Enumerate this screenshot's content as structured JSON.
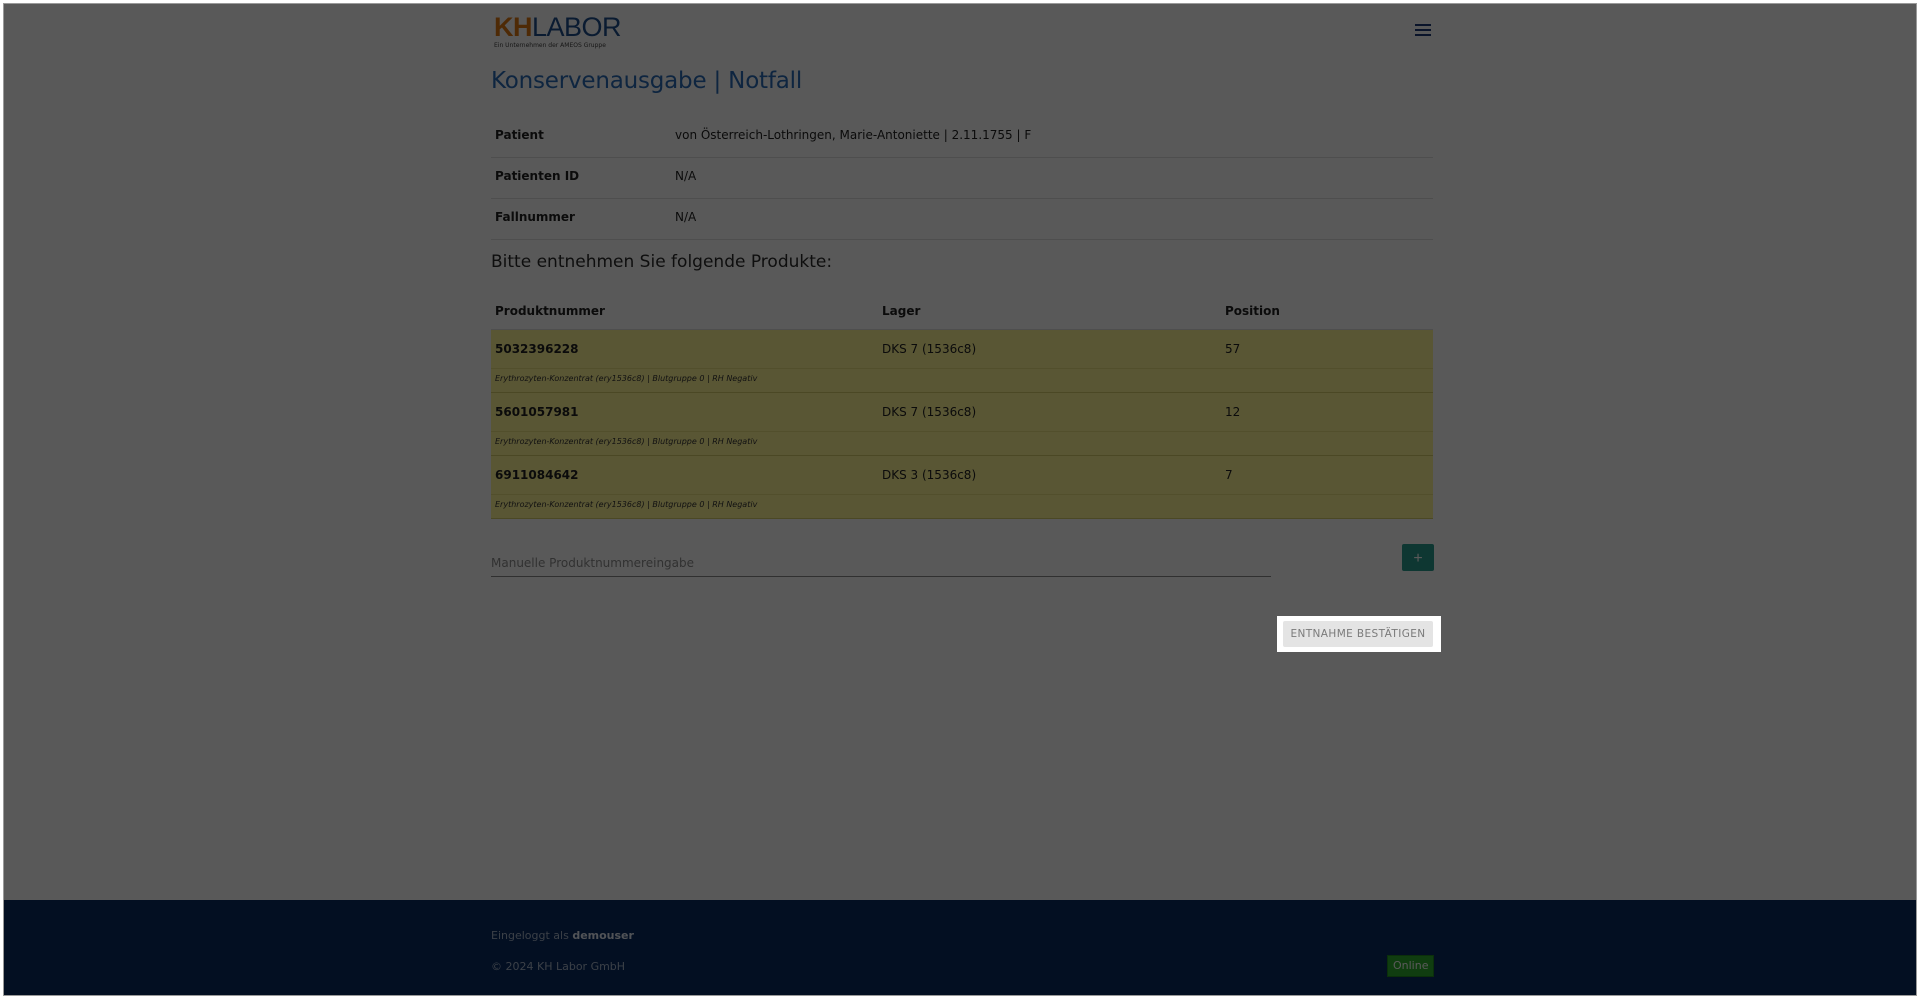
{
  "brand": {
    "logo_kh": "KH",
    "logo_labor": "LABOR",
    "logo_sub": "Ein Unternehmen der AMEOS Gruppe"
  },
  "page": {
    "title": "Konservenausgabe | Notfall"
  },
  "info": [
    {
      "label": "Patient",
      "value": "von Österreich-Lothringen, Marie-Antoniette | 2.11.1755 | F"
    },
    {
      "label": "Patienten ID",
      "value": "N/A"
    },
    {
      "label": "Fallnummer",
      "value": "N/A"
    }
  ],
  "products": {
    "title": "Bitte entnehmen Sie folgende Produkte:",
    "columns": [
      "Produktnummer",
      "Lager",
      "Position"
    ],
    "items": [
      {
        "number": "5032396228",
        "storage": "DKS 7 (1536c8)",
        "position": "57",
        "desc": "Erythrozyten-Konzentrat (ery1536c8) | Blutgruppe 0 | RH Negativ"
      },
      {
        "number": "5601057981",
        "storage": "DKS 7 (1536c8)",
        "position": "12",
        "desc": "Erythrozyten-Konzentrat (ery1536c8) | Blutgruppe 0 | RH Negativ"
      },
      {
        "number": "6911084642",
        "storage": "DKS 3 (1536c8)",
        "position": "7",
        "desc": "Erythrozyten-Konzentrat (ery1536c8) | Blutgruppe 0 | RH Negativ"
      }
    ]
  },
  "manual": {
    "placeholder": "Manuelle Produktnummereingabe",
    "add_label": "+"
  },
  "actions": {
    "confirm_label": "ENTNAHME BESTÄTIGEN"
  },
  "footer": {
    "login_prefix": "Eingeloggt als",
    "username": "demouser",
    "copyright": "© 2024 KH Labor GmbH",
    "status": "Online"
  },
  "colors": {
    "accent": "#2a6cb7",
    "highlight_row": "#fff596",
    "footer_bg": "#0a2c63",
    "status_online": "#2fae2f",
    "add_button": "#2a9d8f"
  },
  "icons": {
    "menu": "hamburger-menu-icon"
  }
}
